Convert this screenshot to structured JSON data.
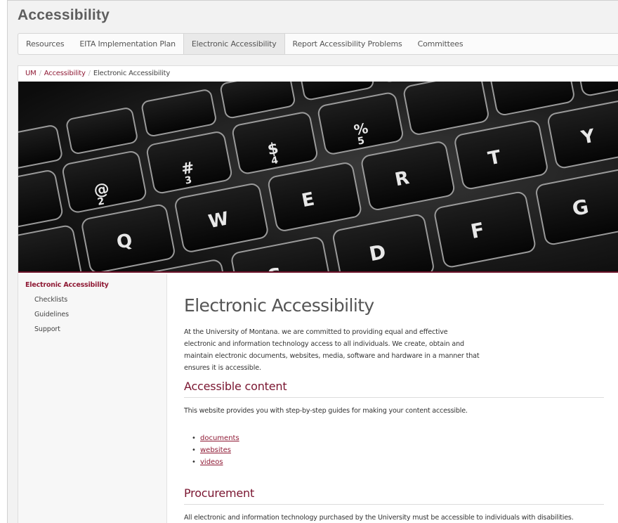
{
  "site": {
    "title": "Accessibility"
  },
  "nav": {
    "items": [
      {
        "label": "Resources"
      },
      {
        "label": "EITA Implementation Plan"
      },
      {
        "label": "Electronic Accessibility",
        "active": true
      },
      {
        "label": "Report Accessibility Problems"
      },
      {
        "label": "Committees"
      }
    ]
  },
  "breadcrumb": {
    "items": [
      "UM",
      "Accessibility",
      "Electronic Accessibility"
    ],
    "separator": "/"
  },
  "hero": {
    "icon": "keyboard-photo"
  },
  "sidebar": {
    "heading": "Electronic Accessibility",
    "items": [
      "Checklists",
      "Guidelines",
      "Support"
    ]
  },
  "main": {
    "title": "Electronic Accessibility",
    "intro": [
      "At the University of Montana. we are committed to providing equal and effective",
      "electronic and information technology access to all individuals. We create, obtain and",
      "maintain electronic documents, websites, media, software and hardware in a manner that",
      "ensures it is accessible."
    ],
    "sections": [
      {
        "heading": "Accessible content",
        "text": "This website provides you with step-by-step guides for making your content accessible.",
        "links": [
          "documents",
          "websites",
          "videos"
        ]
      },
      {
        "heading": "Procurement",
        "text": "All electronic and information technology purchased by the University must be accessible to individuals with disabilities."
      }
    ]
  },
  "colors": {
    "brand": "#8f1a35",
    "heading": "#7a1530",
    "nav_bg": "#fbfbfb",
    "page_bg": "#f2f2f2"
  }
}
